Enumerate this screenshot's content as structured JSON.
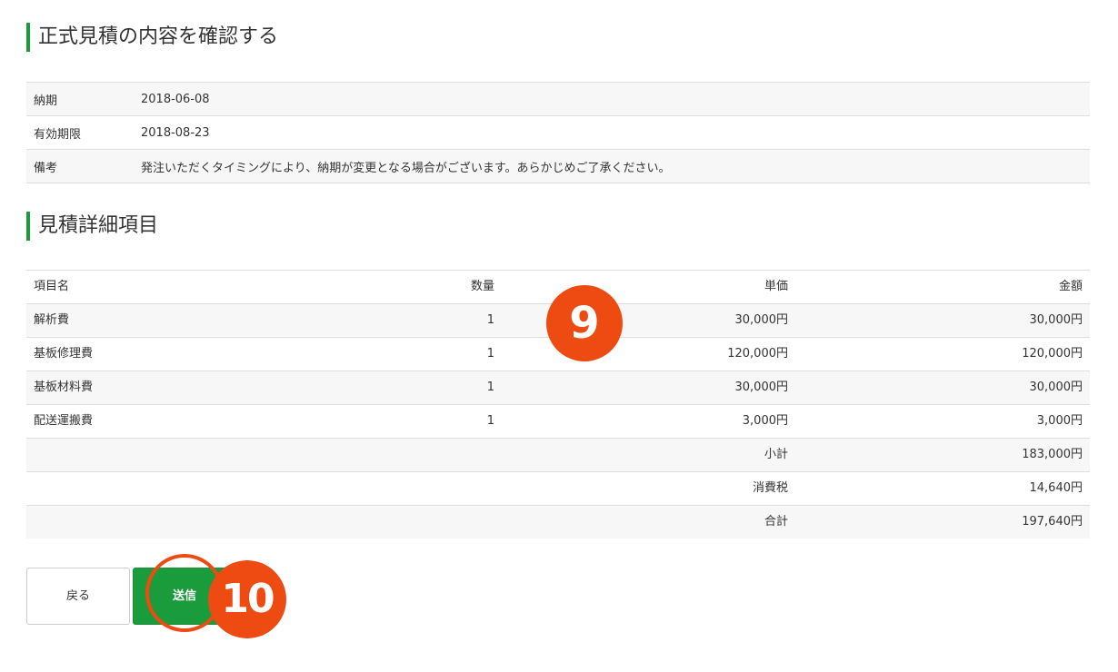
{
  "sections": {
    "confirm_title": "正式見積の内容を確認する",
    "detail_title": "見積詳細項目"
  },
  "info": {
    "rows": [
      {
        "label": "納期",
        "value": "2018-06-08"
      },
      {
        "label": "有効期限",
        "value": "2018-08-23"
      },
      {
        "label": "備考",
        "value": "発注いただくタイミングにより、納期が変更となる場合がございます。あらかじめご了承ください。"
      }
    ]
  },
  "detail": {
    "headers": {
      "name": "項目名",
      "qty": "数量",
      "price": "単価",
      "amount": "金額"
    },
    "items": [
      {
        "name": "解析費",
        "qty": "1",
        "price": "30,000円",
        "amount": "30,000円"
      },
      {
        "name": "基板修理費",
        "qty": "1",
        "price": "120,000円",
        "amount": "120,000円"
      },
      {
        "name": "基板材料費",
        "qty": "1",
        "price": "30,000円",
        "amount": "30,000円"
      },
      {
        "name": "配送運搬費",
        "qty": "1",
        "price": "3,000円",
        "amount": "3,000円"
      }
    ],
    "totals": [
      {
        "label": "小計",
        "value": "183,000円"
      },
      {
        "label": "消費税",
        "value": "14,640円"
      },
      {
        "label": "合計",
        "value": "197,640円"
      }
    ]
  },
  "actions": {
    "back_label": "戻る",
    "send_label": "送信"
  },
  "annotations": {
    "marker_9": "9",
    "marker_10": "10"
  },
  "colors": {
    "accent": "#1a9b3c",
    "marker": "#ee4b12"
  }
}
